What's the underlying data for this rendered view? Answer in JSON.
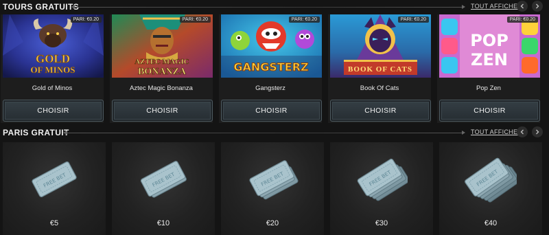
{
  "free_spins": {
    "title": "TOURS GRATUITS",
    "see_all": "TOUT AFFICHER",
    "games": [
      {
        "name": "Gold of Minos",
        "badge": "PARI: €0.20",
        "art_title": "GOLD OF MINOS",
        "button": "CHOISIR"
      },
      {
        "name": "Aztec Magic Bonanza",
        "badge": "PARI: €0.20",
        "art_title": "AZTEC MAGIC BONANZA",
        "button": "CHOISIR"
      },
      {
        "name": "Gangsterz",
        "badge": "PARI: €0.20",
        "art_title": "GANGSTERZ",
        "button": "CHOISIR"
      },
      {
        "name": "Book Of Cats",
        "badge": "PARI: €0.20",
        "art_title": "BOOK OF CATS",
        "button": "CHOISIR"
      },
      {
        "name": "Pop Zen",
        "badge": "PARI: €0.20",
        "art_title": "POP ZEN",
        "button": "CHOISIR"
      }
    ]
  },
  "free_bets": {
    "title": "PARIS GRATUIT",
    "see_all": "TOUT AFFICHER",
    "ticket_text": "FREE BET",
    "items": [
      {
        "amount": "€5"
      },
      {
        "amount": "€10"
      },
      {
        "amount": "€20"
      },
      {
        "amount": "€30"
      },
      {
        "amount": "€40"
      }
    ]
  },
  "icons": {
    "prev": "chevron-left-icon",
    "next": "chevron-right-icon",
    "ticket": "free-bet-ticket-icon"
  },
  "colors": {
    "background": "#141414",
    "card": "#1d1d1d",
    "button_border": "#4d5a60"
  }
}
